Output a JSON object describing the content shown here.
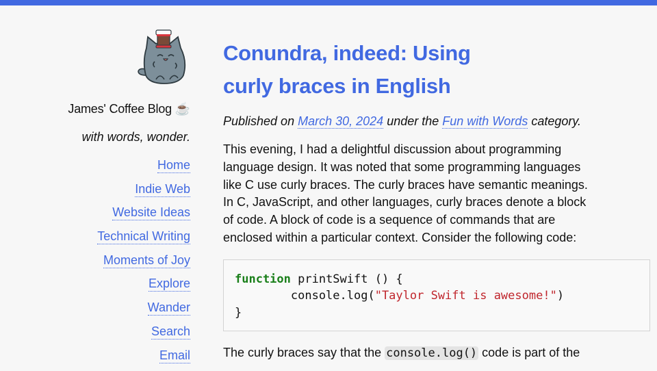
{
  "theme": {
    "accent": "#4169e1",
    "background": "#f7f7f7",
    "keyword_color": "#1a7f1a",
    "string_color": "#c0262d"
  },
  "sidebar": {
    "mascot_icon": "cat-with-coffee-cup",
    "site_title": "James' Coffee Blog ☕",
    "tagline": "with words, wonder.",
    "nav": [
      {
        "label": "Home"
      },
      {
        "label": "Indie Web"
      },
      {
        "label": "Website Ideas"
      },
      {
        "label": "Technical Writing"
      },
      {
        "label": "Moments of Joy"
      },
      {
        "label": "Explore"
      },
      {
        "label": "Wander"
      },
      {
        "label": "Search"
      },
      {
        "label": "Email"
      }
    ]
  },
  "post": {
    "title": "Conundra, indeed: Using curly braces in English",
    "meta": {
      "prefix": "Published on",
      "date": "March 30, 2024",
      "middle": "under the",
      "category": "Fun with Words",
      "suffix": "category."
    },
    "paragraph1": "This evening, I had a delightful discussion about programming language design. It was noted that some programming languages like C use curly braces. The curly braces have semantic meanings. In C, JavaScript, and other languages, curly braces denote a block of code. A block of code is a sequence of commands that are enclosed within a particular context. Consider the following code:",
    "code": {
      "keyword": "function",
      "line1_rest": " printSwift () {",
      "line2_prefix": "        console.log(",
      "line2_string": "\"Taylor Swift is awesome!\"",
      "line2_suffix": ")",
      "line3": "}"
    },
    "paragraph2": {
      "before": "The curly braces say that the ",
      "code": "console.log()",
      "after": " code is part of the"
    }
  }
}
